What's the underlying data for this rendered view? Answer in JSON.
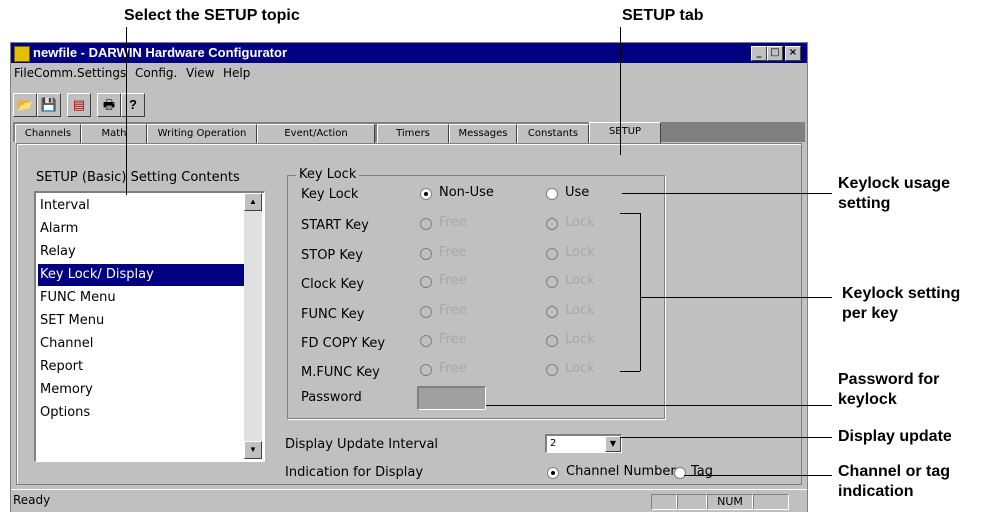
{
  "callouts": {
    "select_topic": "Select the SETUP topic",
    "setup_tab": "SETUP tab",
    "keylock_usage": [
      "Keylock usage",
      "setting"
    ],
    "keylock_per_key": [
      "Keylock setting",
      "per key"
    ],
    "password": [
      "Password for",
      "keylock"
    ],
    "display_update": "Display update",
    "channel_tag": [
      "Channel or tag",
      "indication"
    ]
  },
  "window": {
    "title": "newfile - DARWIN Hardware Configurator",
    "controls": [
      "_",
      "□",
      "×"
    ]
  },
  "menu": [
    "File",
    "Comm.",
    "Settings",
    "Config.",
    "View",
    "Help"
  ],
  "toolbar": {
    "icons": [
      "open-folder-icon",
      "save-icon",
      "transfer-icon",
      "print-icon",
      "help-icon"
    ],
    "glyphs": [
      "📂",
      "💾",
      "▤",
      "🖶",
      "?"
    ]
  },
  "tabs": [
    "Channels",
    "Math",
    "Writing Operation",
    "Event/Action",
    "Timers",
    "Messages",
    "Constants",
    "SETUP"
  ],
  "active_tab": "SETUP",
  "setup_list": {
    "heading": "SETUP (Basic) Setting Contents",
    "items": [
      "Interval",
      "Alarm",
      "Relay",
      "Key Lock/ Display",
      "FUNC Menu",
      "SET Menu",
      "Channel",
      "Report",
      "Memory",
      "Options"
    ],
    "selected": "Key Lock/ Display"
  },
  "keylock": {
    "group_title": "Key Lock",
    "row_label": "Key Lock",
    "non_use": "Non-Use",
    "use": "Use",
    "selected": "Non-Use",
    "keys": [
      "START Key",
      "STOP Key",
      "Clock Key",
      "FUNC Key",
      "FD COPY Key",
      "M.FUNC Key"
    ],
    "free": "Free",
    "lock": "Lock",
    "password_label": "Password"
  },
  "display": {
    "update_label": "Display Update Interval",
    "update_value": "2",
    "indication_label": "Indication for Display",
    "channel_number": "Channel Number",
    "tag": "Tag",
    "selected": "Channel Number"
  },
  "status": {
    "text": "Ready",
    "num": "NUM"
  }
}
